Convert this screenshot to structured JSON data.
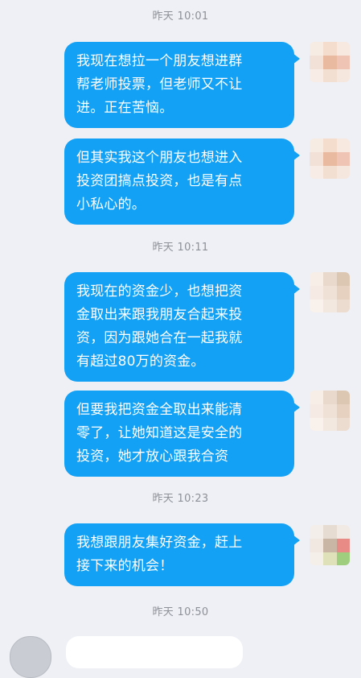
{
  "timestamps": [
    "昨天 10:01",
    "昨天 10:11",
    "昨天 10:23",
    "昨天 10:50"
  ],
  "messages": [
    {
      "sender": "me",
      "lines": [
        "我现在想拉一个朋友想进群",
        "帮老师投票，但老师又不让",
        "进。正在苦恼。"
      ]
    },
    {
      "sender": "me",
      "lines": [
        "但其实我这个朋友也想进入",
        "投资团搞点投资，也是有点",
        "小私心的。"
      ]
    },
    {
      "sender": "me",
      "lines": [
        "我现在的资金少，也想把资",
        "金取出来跟我朋友合起来投",
        "资，因为跟她合在一起我就",
        "有超过80万的资金。"
      ]
    },
    {
      "sender": "me",
      "lines": [
        "但要我把资金全取出来能清",
        "零了，让她知道这是安全的",
        "投资，她才放心跟我合资"
      ]
    },
    {
      "sender": "me",
      "lines": [
        "我想跟朋友集好资金，赶上",
        "接下来的机会！"
      ]
    }
  ],
  "colors": {
    "background": "#eef0f6",
    "outgoing_bubble": "#12a1f5",
    "outgoing_text": "#ffffff",
    "timestamp_text": "#8e9097",
    "incoming_bubble": "#ffffff"
  },
  "icons": {
    "my_avatar": "avatar-pixelated-icon",
    "contact_avatar": "avatar-icon"
  }
}
